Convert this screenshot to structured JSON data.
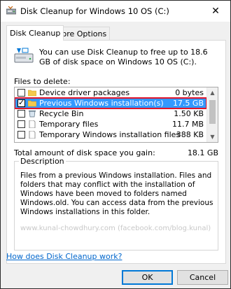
{
  "window": {
    "title": "Disk Cleanup for Windows 10 OS (C:)",
    "close_glyph": "✕"
  },
  "tabs": [
    {
      "label": "Disk Cleanup",
      "active": true
    },
    {
      "label": "More Options",
      "active": false
    }
  ],
  "intro": "You can use Disk Cleanup to free up to 18.6 GB of disk space on Windows 10 OS (C:).",
  "files_label": "Files to delete:",
  "files": [
    {
      "name": "Device driver packages",
      "size": "0 bytes",
      "checked": false,
      "icon": "folder-icon"
    },
    {
      "name": "Previous Windows installation(s)",
      "size": "17.5 GB",
      "checked": true,
      "selected": true,
      "icon": "folder-icon"
    },
    {
      "name": "Recycle Bin",
      "size": "1.50 KB",
      "checked": false,
      "icon": "recycle-bin-icon"
    },
    {
      "name": "Temporary files",
      "size": "11.7 MB",
      "checked": false,
      "icon": "document-icon"
    },
    {
      "name": "Temporary Windows installation files",
      "size": "388 KB",
      "checked": false,
      "icon": "document-icon"
    }
  ],
  "total_label": "Total amount of disk space you gain:",
  "total_value": "18.1 GB",
  "description": {
    "legend": "Description",
    "text": "Files from a previous Windows installation.  Files and folders that may conflict with the installation of Windows have been moved to folders named Windows.old.  You can access data from the previous Windows installations in this folder.",
    "watermark": "www.kunal-chowdhury.com (facebook.com/blog.kunal)"
  },
  "help_link": "How does Disk Cleanup work?",
  "buttons": {
    "ok": "OK",
    "cancel": "Cancel"
  },
  "colors": {
    "selection": "#3399ff",
    "highlight_border": "#e0142b",
    "link": "#0066cc"
  }
}
